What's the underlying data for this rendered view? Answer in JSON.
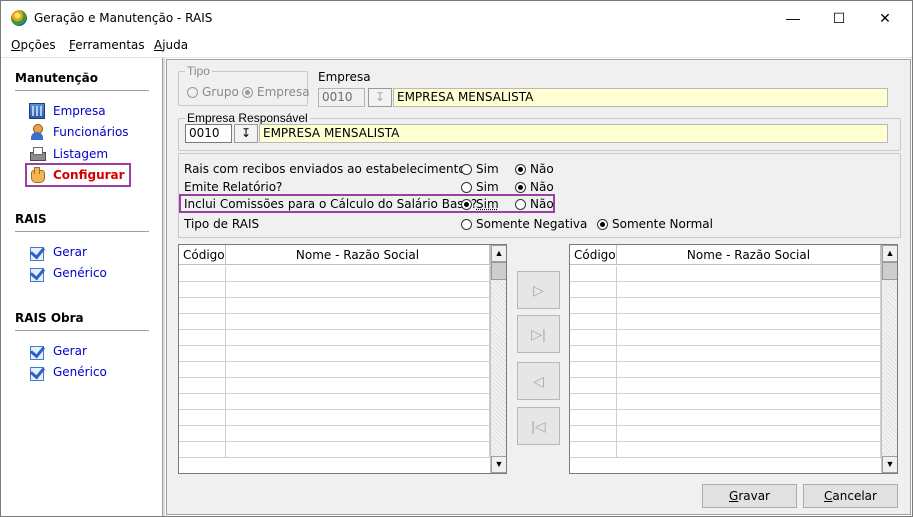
{
  "window": {
    "title": "Geração e Manutenção - RAIS"
  },
  "menu": [
    {
      "pre": "",
      "u": "O",
      "post": "pções"
    },
    {
      "pre": "",
      "u": "F",
      "post": "erramentas"
    },
    {
      "pre": "",
      "u": "A",
      "post": "juda"
    }
  ],
  "sidebar": {
    "sections": [
      {
        "title": "Manutenção",
        "items": [
          "Empresa",
          "Funcionários",
          "Listagem",
          "Configurar"
        ]
      },
      {
        "title": "RAIS",
        "items": [
          "Gerar",
          "Genérico"
        ]
      },
      {
        "title": "RAIS Obra",
        "items": [
          "Gerar",
          "Genérico"
        ]
      }
    ],
    "active_item": "Configurar"
  },
  "form": {
    "tipo": {
      "legend": "Tipo",
      "options": [
        "Grupo",
        "Empresa"
      ],
      "selected": "Empresa"
    },
    "empresa": {
      "label": "Empresa",
      "code": "0010",
      "name": "EMPRESA MENSALISTA"
    },
    "empresa_responsavel": {
      "legend": "Empresa Responsável",
      "code": "0010",
      "name": "EMPRESA MENSALISTA"
    },
    "questions": [
      {
        "label": "Rais com recibos enviados ao estabelecimento",
        "opt1": "Sim",
        "opt2": "Não",
        "selected": "Não"
      },
      {
        "label": "Emite Relatório?",
        "opt1": "Sim",
        "opt2": "Não",
        "selected": "Não"
      },
      {
        "label": "Inclui Comissões para o Cálculo do Salário Base?",
        "opt1": "Sim",
        "opt2": "Não",
        "selected": "Sim"
      },
      {
        "label": "Tipo de RAIS",
        "opt1": "Somente Negativa",
        "opt2": "Somente Normal",
        "selected": "Somente Normal"
      }
    ]
  },
  "grids": {
    "left": {
      "col1": "Código",
      "col2": "Nome - Razão Social"
    },
    "right": {
      "col1": "Código",
      "col2": "Nome - Razão Social"
    }
  },
  "transfer_buttons": [
    "move-right",
    "move-all-right",
    "move-left",
    "move-all-left"
  ],
  "buttons": {
    "gravar": {
      "u": "G",
      "post": "ravar"
    },
    "cancelar": {
      "u": "C",
      "post": "ancelar"
    }
  }
}
